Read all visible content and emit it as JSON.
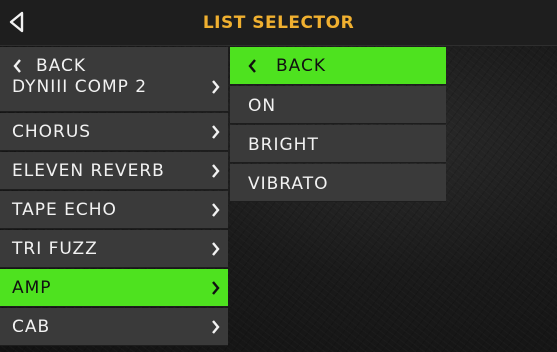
{
  "header": {
    "title": "LIST SELECTOR",
    "back_icon": "triangle-left-icon",
    "title_color": "#f0b030"
  },
  "left_list": {
    "items": [
      {
        "label": "BACK",
        "type": "back",
        "selected": false
      },
      {
        "label": "DYNIII COMP 2",
        "type": "submenu",
        "selected": false
      },
      {
        "label": "CHORUS",
        "type": "submenu",
        "selected": false
      },
      {
        "label": "ELEVEN REVERB",
        "type": "submenu",
        "selected": false
      },
      {
        "label": "TAPE ECHO",
        "type": "submenu",
        "selected": false
      },
      {
        "label": "TRI FUZZ",
        "type": "submenu",
        "selected": false
      },
      {
        "label": "AMP",
        "type": "submenu",
        "selected": true
      },
      {
        "label": "CAB",
        "type": "submenu",
        "selected": false
      }
    ]
  },
  "right_list": {
    "items": [
      {
        "label": "BACK",
        "type": "back",
        "selected": true
      },
      {
        "label": "ON",
        "type": "option",
        "selected": false
      },
      {
        "label": "BRIGHT",
        "type": "option",
        "selected": false
      },
      {
        "label": "VIBRATO",
        "type": "option",
        "selected": false
      }
    ]
  },
  "colors": {
    "accent_green": "#4ee21f",
    "item_bg": "#3a3a3a",
    "text": "#f2f2f2"
  }
}
